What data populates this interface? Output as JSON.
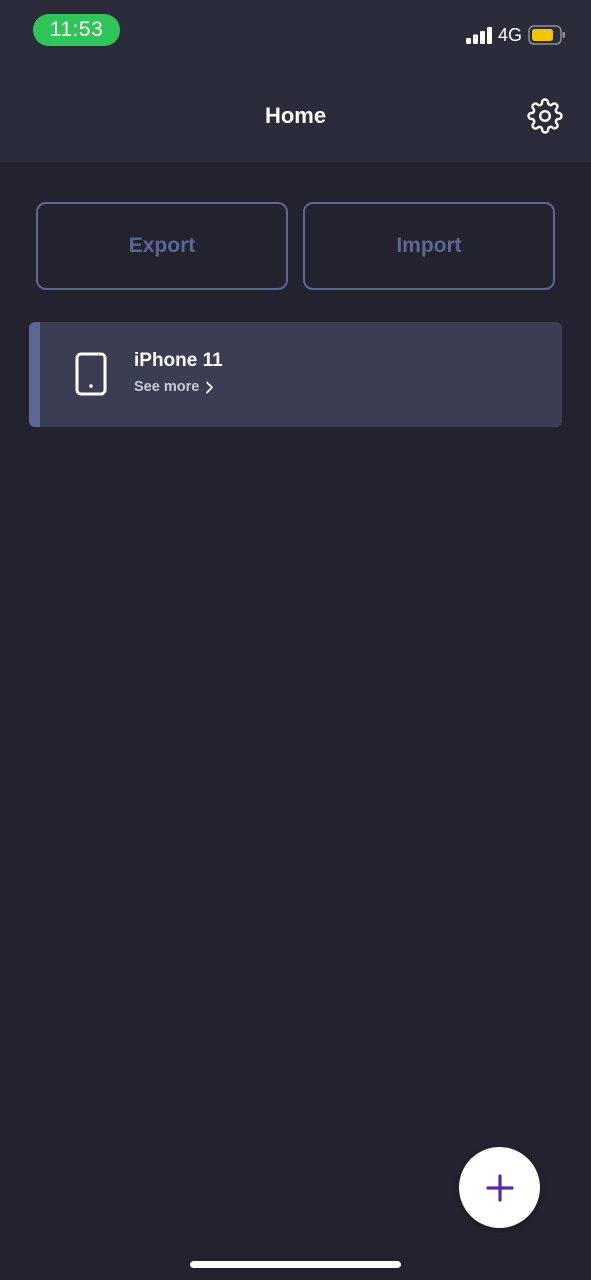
{
  "status_bar": {
    "time": "11:53",
    "network": "4G",
    "time_pill_color": "#30c55a",
    "battery_color": "#f5c400",
    "icons": [
      "signal-icon",
      "battery-icon"
    ]
  },
  "header": {
    "title": "Home",
    "settings_icon": "gear-icon"
  },
  "actions": {
    "export_label": "Export",
    "import_label": "Import",
    "accent_color": "#5c6796"
  },
  "devices": [
    {
      "name": "iPhone 11",
      "link_label": "See more",
      "icon": "phone-icon"
    }
  ],
  "fab": {
    "icon": "plus-icon",
    "icon_color": "#5a2aa0"
  },
  "colors": {
    "background": "#22232e",
    "header_bg": "#2a2c3a",
    "card_bg": "#3b3d52"
  }
}
